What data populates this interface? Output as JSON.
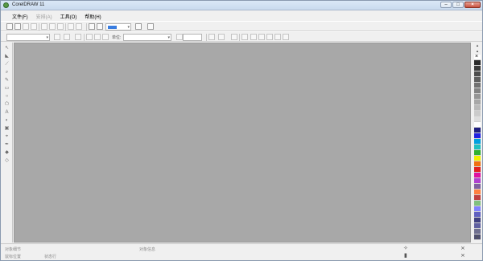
{
  "window": {
    "title": "CorelDRAW 11"
  },
  "window_controls": {
    "minimize": "–",
    "maximize": "□",
    "close": "×"
  },
  "menu": {
    "items": [
      {
        "label": "文件(F)",
        "enabled": true
      },
      {
        "label": "安排(A)",
        "enabled": false
      },
      {
        "label": "工具(O)",
        "enabled": true
      },
      {
        "label": "帮助(H)",
        "enabled": true
      }
    ]
  },
  "toolbar2": {
    "units_label": "单位:"
  },
  "colors": {
    "canvas": "#a8a8a8",
    "palette": [
      "#ffffff",
      "#2a2a2a",
      "#3b3b3b",
      "#4d4d4d",
      "#5f5f5f",
      "#717171",
      "#838383",
      "#959595",
      "#a7a7a7",
      "#b9b9b9",
      "#cbcbcb",
      "#dddddd",
      "#ffffff",
      "#1f1f80",
      "#2020e0",
      "#00a0e0",
      "#20c0c0",
      "#30b030",
      "#f0f000",
      "#f07010",
      "#e02020",
      "#e010a0",
      "#b040d0",
      "#8060a0",
      "#ff8040",
      "#c04040",
      "#80c080",
      "#8080ff",
      "#6060c0",
      "#404080",
      "#6060a0",
      "#707090",
      "#505070"
    ]
  },
  "status": {
    "object_details": "对象细节",
    "object_info": "对象信息",
    "cursor_position": "鼠标位置",
    "status_line": "状态行"
  }
}
